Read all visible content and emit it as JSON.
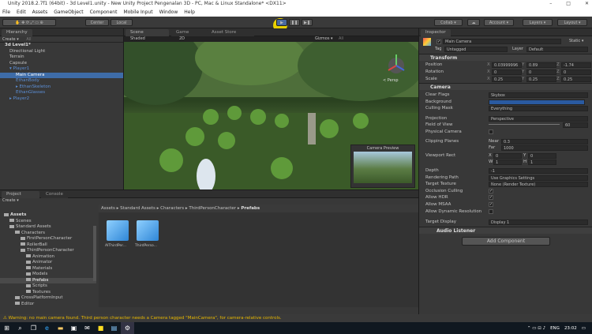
{
  "title": "Unity 2018.2.7f1 (64bit) - 3d Level1.unity - New Unity Project Pengenalan 3D - PC, Mac & Linux Standalone* <DX11>",
  "menu": [
    "File",
    "Edit",
    "Assets",
    "GameObject",
    "Component",
    "Mobile Input",
    "Window",
    "Help"
  ],
  "toolbar": {
    "center": "Center",
    "local": "Local",
    "collab": "Collab ▾",
    "account": "Account ▾",
    "layers": "Layers ▾",
    "layout": "Layout ▾"
  },
  "hierarchy": {
    "tab": "Hierarchy",
    "create": "Create ▾",
    "search": "All",
    "scene": "3d Level1*",
    "items": [
      {
        "label": "Directional Light",
        "indent": 1,
        "style": "normal"
      },
      {
        "label": "Terrain",
        "indent": 1,
        "style": "normal"
      },
      {
        "label": "Capsule",
        "indent": 1,
        "style": "normal"
      },
      {
        "label": "▾ Player1",
        "indent": 1,
        "style": "blue"
      },
      {
        "label": "Main Camera",
        "indent": 2,
        "style": "selected"
      },
      {
        "label": "EthanBody",
        "indent": 2,
        "style": "blue"
      },
      {
        "label": "▸ EthanSkeleton",
        "indent": 2,
        "style": "blue"
      },
      {
        "label": "EthanGlasses",
        "indent": 2,
        "style": "blue"
      },
      {
        "label": "▸ Player2",
        "indent": 1,
        "style": "blue"
      }
    ]
  },
  "scene": {
    "tabs": [
      "Scene",
      "Game",
      "Asset Store"
    ],
    "shading": "Shaded",
    "mode2d": "2D",
    "gizmos": "Gizmos ▾",
    "search": "All",
    "persp": "< Persp",
    "camera_preview": "Camera Preview"
  },
  "inspector": {
    "tab": "Inspector",
    "object": "Main Camera",
    "static": "Static ▾",
    "tag_label": "Tag",
    "tag": "Untagged",
    "layer_label": "Layer",
    "layer": "Default",
    "transform": {
      "title": "Transform",
      "position": [
        "Position",
        "0.03999996",
        "0.89",
        "-1.74"
      ],
      "rotation": [
        "Rotation",
        "0",
        "0",
        "0"
      ],
      "scale": [
        "Scale",
        "0.25",
        "0.25",
        "0.25"
      ]
    },
    "camera": {
      "title": "Camera",
      "clear_flags": [
        "Clear Flags",
        "Skybox"
      ],
      "background": "Background",
      "culling": [
        "Culling Mask",
        "Everything"
      ],
      "projection": [
        "Projection",
        "Perspective"
      ],
      "fov": [
        "Field of View",
        "60"
      ],
      "physical": "Physical Camera",
      "clipping": "Clipping Planes",
      "near": [
        "Near",
        "0.3"
      ],
      "far": [
        "Far",
        "1000"
      ],
      "viewport": "Viewport Rect",
      "vx": [
        "X",
        "0"
      ],
      "vy": [
        "Y",
        "0"
      ],
      "vw": [
        "W",
        "1"
      ],
      "vh": [
        "H",
        "1"
      ],
      "depth": [
        "Depth",
        "-1"
      ],
      "rendering": [
        "Rendering Path",
        "Use Graphics Settings"
      ],
      "target_tex": [
        "Target Texture",
        "None (Render Texture)"
      ],
      "occlusion": "Occlusion Culling",
      "hdr": "Allow HDR",
      "msaa": "Allow MSAA",
      "dynres": "Allow Dynamic Resolution",
      "display": [
        "Target Display",
        "Display 1"
      ],
      "background_color": "#2a5aa0"
    },
    "audio": "Audio Listener",
    "add_component": "Add Component"
  },
  "project": {
    "tabs": [
      "Project",
      "Console"
    ],
    "create": "Create ▾",
    "tree": [
      {
        "label": "Assets",
        "indent": 0,
        "bold": true
      },
      {
        "label": "Scenes",
        "indent": 1
      },
      {
        "label": "Standard Assets",
        "indent": 1
      },
      {
        "label": "Characters",
        "indent": 2
      },
      {
        "label": "FirstPersonCharacter",
        "indent": 3
      },
      {
        "label": "RollerBall",
        "indent": 3
      },
      {
        "label": "ThirdPersonCharacter",
        "indent": 3
      },
      {
        "label": "Animation",
        "indent": 4
      },
      {
        "label": "Animator",
        "indent": 4
      },
      {
        "label": "Materials",
        "indent": 4
      },
      {
        "label": "Models",
        "indent": 4
      },
      {
        "label": "Prefabs",
        "indent": 4,
        "selected": true
      },
      {
        "label": "Scripts",
        "indent": 4
      },
      {
        "label": "Textures",
        "indent": 4
      },
      {
        "label": "CrossPlatformInput",
        "indent": 2
      },
      {
        "label": "Editor",
        "indent": 2
      }
    ],
    "breadcrumb": [
      "Assets",
      "Standard Assets",
      "Characters",
      "ThirdPersonCharacter",
      "Prefabs"
    ],
    "assets": [
      "AIThirdPer...",
      "ThirdPerso..."
    ]
  },
  "status": "⚠ Warning: no main camera found. Third person character needs a Camera tagged \"MainCamera\", for camera-relative controls.",
  "taskbar": {
    "lang": "ENG",
    "time": "23:02"
  }
}
